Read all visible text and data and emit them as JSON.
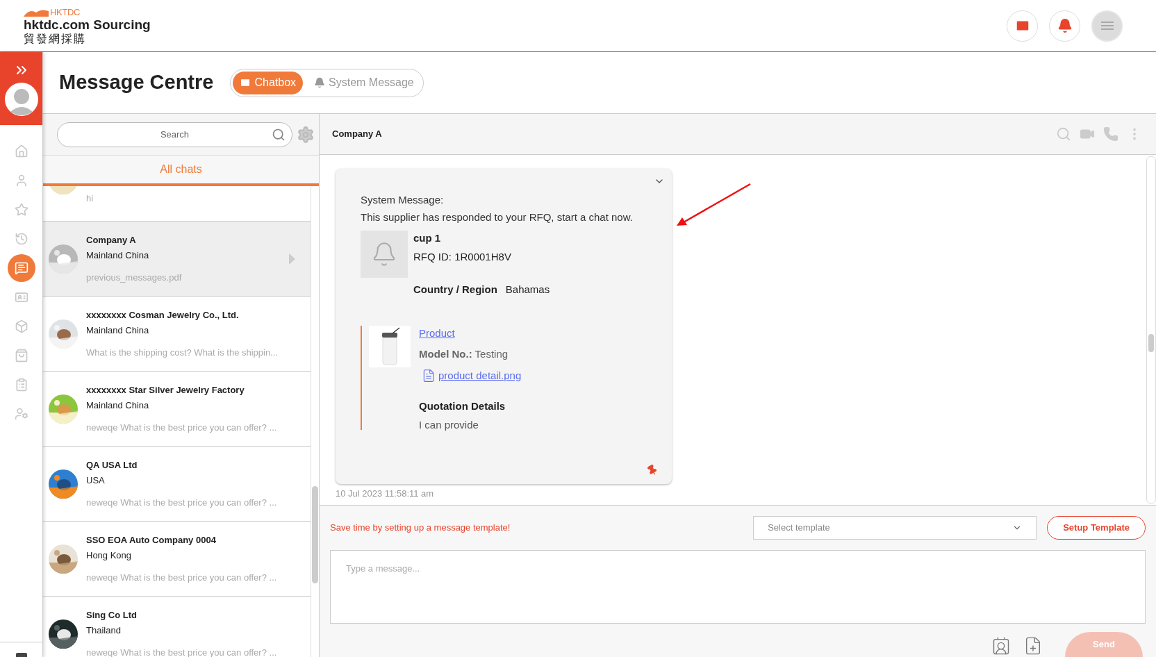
{
  "header": {
    "logo_mark": "HKTDC",
    "brand": "hktdc.com Sourcing",
    "brand_chinese": "貿發網採購"
  },
  "sidebar": {
    "items": [
      {
        "selected": false
      },
      {
        "selected": false
      },
      {
        "selected": false
      },
      {
        "selected": false
      },
      {
        "selected": true
      },
      {
        "selected": false
      },
      {
        "selected": false
      },
      {
        "selected": false
      },
      {
        "selected": false
      },
      {
        "selected": false
      }
    ]
  },
  "page": {
    "title": "Message Centre",
    "tabs": [
      {
        "label": "Chatbox",
        "selected": true
      },
      {
        "label": "System Message",
        "selected": false
      }
    ]
  },
  "chat_list": {
    "search": {
      "placeholder": "Search"
    },
    "filter": "All chats",
    "partial_row": {
      "preview": "hi"
    },
    "rows": [
      {
        "name": "Company A",
        "location": "Mainland China",
        "preview": "previous_messages.pdf",
        "selected": true
      },
      {
        "name": "xxxxxxxx Cosman Jewelry Co., Ltd.",
        "location": "Mainland China",
        "preview": "What is the shipping cost? What is the shippin...",
        "selected": false
      },
      {
        "name": "xxxxxxxx Star Silver Jewelry Factory",
        "location": "Mainland China",
        "preview": "neweqe What is the best price you can offer? ...",
        "selected": false
      },
      {
        "name": "QA USA Ltd",
        "location": "USA",
        "preview": "neweqe What is the best price you can offer? ...",
        "selected": false
      },
      {
        "name": "SSO EOA Auto Company 0004",
        "location": "Hong Kong",
        "preview": "neweqe What is the best price you can offer? ...",
        "selected": false
      },
      {
        "name": "Sing Co Ltd",
        "location": "Thailand",
        "preview": "neweqe What is the best price you can offer? ...",
        "selected": false
      }
    ]
  },
  "conversation": {
    "title": "Company A",
    "message": {
      "heading": "System Message:",
      "text": "This supplier has responded to your RFQ, start a chat now.",
      "rfq_title": "cup 1",
      "rfq_id": "RFQ ID: 1R0001H8V",
      "country_label": "Country / Region",
      "country_value": "Bahamas",
      "product_link": "Product",
      "model": "**Model No.:** Testing",
      "attachment": "product detail.png",
      "quotation_label": "Quotation Details",
      "quotation_text": "I can provide",
      "timestamp": "10 Jul 2023 11:58:11 am"
    },
    "composer": {
      "hint": "Save time by setting up a message template!",
      "template_placeholder": "Select template",
      "setup_button": "Setup Template",
      "message_placeholder": "Type a message...",
      "send_button": "Send"
    }
  }
}
